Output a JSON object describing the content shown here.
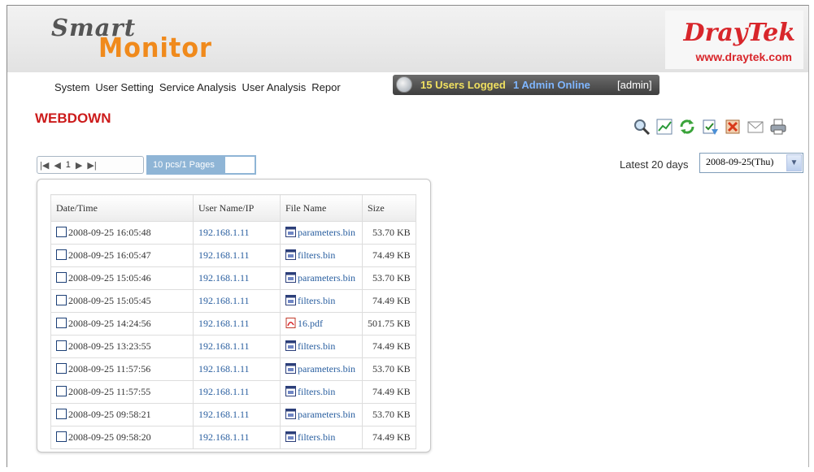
{
  "header": {
    "logo_line1": "Smart",
    "logo_line2": "Monitor",
    "brand_name": "DrayTek",
    "brand_url": "www.draytek.com"
  },
  "menu": {
    "items": [
      "System",
      "User Setting",
      "Service Analysis",
      "User Analysis",
      "Repor"
    ]
  },
  "status": {
    "users": "15 Users Logged",
    "admins": "1 Admin Online",
    "user": "[admin]"
  },
  "page": {
    "title": "WEBDOWN"
  },
  "toolbar": {
    "icons": [
      "search-icon",
      "chart-icon",
      "refresh-icon",
      "export-icon",
      "delete-icon",
      "mail-icon",
      "print-icon"
    ]
  },
  "pager": {
    "first": "|◀",
    "prev": "◀",
    "current": "1",
    "next": "▶",
    "last": "▶|",
    "info": "10 pcs/1 Pages"
  },
  "filter": {
    "range_label": "Latest 20 days",
    "date": "2008-09-25(Thu)"
  },
  "colors": {
    "title": "#cc1b1b",
    "link": "#2a5fa0",
    "accent": "#f08a1c",
    "brand": "#d8262b"
  },
  "table": {
    "headers": [
      "Date/Time",
      "User Name/IP",
      "File Name",
      "Size"
    ],
    "rows": [
      {
        "datetime": "2008-09-25 16:05:48",
        "ip": "192.168.1.11",
        "file": "parameters.bin",
        "type": "bin",
        "size": "53.70 KB"
      },
      {
        "datetime": "2008-09-25 16:05:47",
        "ip": "192.168.1.11",
        "file": "filters.bin",
        "type": "bin",
        "size": "74.49 KB"
      },
      {
        "datetime": "2008-09-25 15:05:46",
        "ip": "192.168.1.11",
        "file": "parameters.bin",
        "type": "bin",
        "size": "53.70 KB"
      },
      {
        "datetime": "2008-09-25 15:05:45",
        "ip": "192.168.1.11",
        "file": "filters.bin",
        "type": "bin",
        "size": "74.49 KB"
      },
      {
        "datetime": "2008-09-25 14:24:56",
        "ip": "192.168.1.11",
        "file": "16.pdf",
        "type": "pdf",
        "size": "501.75 KB"
      },
      {
        "datetime": "2008-09-25 13:23:55",
        "ip": "192.168.1.11",
        "file": "filters.bin",
        "type": "bin",
        "size": "74.49 KB"
      },
      {
        "datetime": "2008-09-25 11:57:56",
        "ip": "192.168.1.11",
        "file": "parameters.bin",
        "type": "bin",
        "size": "53.70 KB"
      },
      {
        "datetime": "2008-09-25 11:57:55",
        "ip": "192.168.1.11",
        "file": "filters.bin",
        "type": "bin",
        "size": "74.49 KB"
      },
      {
        "datetime": "2008-09-25 09:58:21",
        "ip": "192.168.1.11",
        "file": "parameters.bin",
        "type": "bin",
        "size": "53.70 KB"
      },
      {
        "datetime": "2008-09-25 09:58:20",
        "ip": "192.168.1.11",
        "file": "filters.bin",
        "type": "bin",
        "size": "74.49 KB"
      }
    ]
  }
}
